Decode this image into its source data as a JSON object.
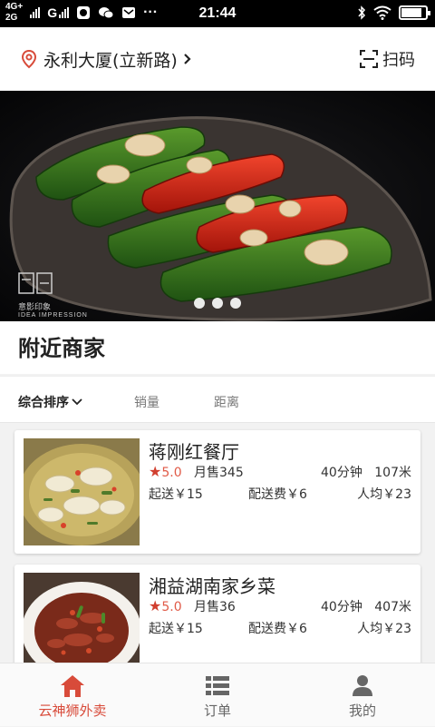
{
  "status_bar": {
    "network_top": "4G+",
    "network_bottom": "2G",
    "carrier": "G",
    "time": "21:44",
    "battery_level": 0.85
  },
  "header": {
    "location": "永利大厦(立新路)",
    "scan_label": "扫码",
    "icons": [
      "location-pin-icon",
      "chevron-right-icon",
      "scan-icon"
    ]
  },
  "banner": {
    "watermark_line1": "意影印象",
    "watermark_line2": "IDEA IMPRESSION",
    "slide_count": 3
  },
  "section_title": "附近商家",
  "sort": {
    "options": [
      "综合排序",
      "销量",
      "距离"
    ],
    "active_index": 0
  },
  "restaurants": [
    {
      "name": "蒋刚红餐厅",
      "rating": "5.0",
      "monthly_sales": "月售345",
      "delivery_time": "40分钟",
      "distance": "107米",
      "min_order": "起送￥15",
      "delivery_fee": "配送费￥6",
      "avg_price": "人均￥23"
    },
    {
      "name": "湘益湖南家乡菜",
      "rating": "5.0",
      "monthly_sales": "月售36",
      "delivery_time": "40分钟",
      "distance": "407米",
      "min_order": "起送￥15",
      "delivery_fee": "配送费￥6",
      "avg_price": "人均￥23"
    }
  ],
  "tabbar": {
    "items": [
      {
        "label": "云神狮外卖",
        "icon": "home-icon"
      },
      {
        "label": "订单",
        "icon": "list-icon"
      },
      {
        "label": "我的",
        "icon": "user-icon"
      }
    ],
    "active_index": 0
  },
  "colors": {
    "accent": "#d84b3a",
    "star": "#d13f2f"
  }
}
